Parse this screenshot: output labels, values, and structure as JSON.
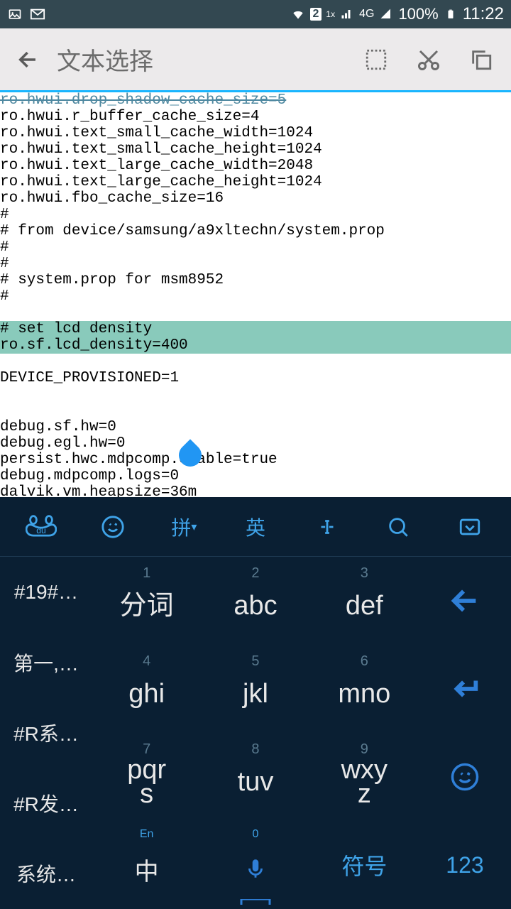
{
  "status": {
    "battery": "100%",
    "time": "11:22",
    "net": "4G",
    "sig2": "1x",
    "sim": "2"
  },
  "appbar": {
    "title": "文本选择"
  },
  "editor": {
    "cutoff": "ro.hwui.drop_shadow_cache_size=5",
    "lines_before": [
      "ro.hwui.r_buffer_cache_size=4",
      "ro.hwui.text_small_cache_width=1024",
      "ro.hwui.text_small_cache_height=1024",
      "ro.hwui.text_large_cache_width=2048",
      "ro.hwui.text_large_cache_height=1024",
      "ro.hwui.fbo_cache_size=16",
      "#",
      "# from device/samsung/a9xltechn/system.prop",
      "#",
      "#",
      "# system.prop for msm8952",
      "#",
      ""
    ],
    "selection": [
      "# set lcd density",
      "ro.sf.lcd_density=400"
    ],
    "lines_after": [
      "",
      "DEVICE_PROVISIONED=1",
      "",
      "",
      "debug.sf.hw=0",
      "debug.egl.hw=0",
      "persist.hwc.mdpcomp.enable=true",
      "debug.mdpcomp.logs=0",
      "dalvik.vm.heapsize=36m"
    ]
  },
  "kb": {
    "top": {
      "pin": "拼",
      "eng": "英"
    },
    "sides": [
      "#19#…",
      "第一,…",
      "#R系…",
      "#R发…",
      "系统…"
    ],
    "keys": {
      "r1": [
        {
          "n": "1",
          "m": "分词"
        },
        {
          "n": "2",
          "m": "abc"
        },
        {
          "n": "3",
          "m": "def"
        }
      ],
      "r2": [
        {
          "n": "4",
          "m": "ghi"
        },
        {
          "n": "5",
          "m": "jkl"
        },
        {
          "n": "6",
          "m": "mno"
        }
      ],
      "r3": [
        {
          "n": "7",
          "m": "pqr\ns"
        },
        {
          "n": "8",
          "m": "tuv"
        },
        {
          "n": "9",
          "m": "wxy\nz"
        }
      ],
      "r4": [
        {
          "t": "En",
          "m": "中"
        },
        {
          "t": "0",
          "m": "🎤"
        },
        {
          "t": "",
          "m": "符号"
        }
      ]
    },
    "actions": {
      "del": "←",
      "enter": "↵",
      "emoji": "☺",
      "num": "123"
    }
  }
}
